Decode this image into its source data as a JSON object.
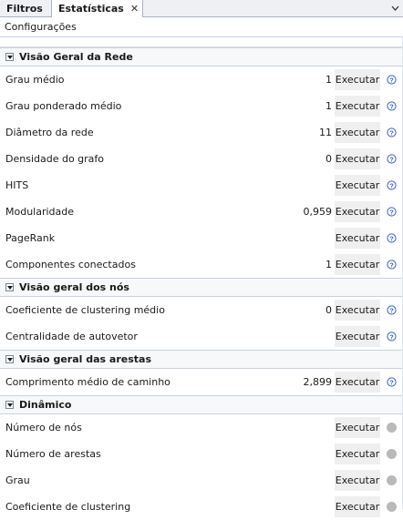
{
  "tabs": [
    {
      "label": "Filtros",
      "active": false
    },
    {
      "label": "Estatísticas",
      "active": true,
      "close": "✕"
    }
  ],
  "toolbar": {
    "configurations_label": "Configurações"
  },
  "run_label": "Executar",
  "sections": [
    {
      "title": "Visão Geral da Rede",
      "rows": [
        {
          "label": "Grau médio",
          "value": "1",
          "indicator": "help"
        },
        {
          "label": "Grau ponderado médio",
          "value": "1",
          "indicator": "help"
        },
        {
          "label": "Diâmetro da rede",
          "value": "11",
          "indicator": "help"
        },
        {
          "label": "Densidade do grafo",
          "value": "0",
          "indicator": "help"
        },
        {
          "label": "HITS",
          "value": "",
          "indicator": "help"
        },
        {
          "label": "Modularidade",
          "value": "0,959",
          "indicator": "help"
        },
        {
          "label": "PageRank",
          "value": "",
          "indicator": "help"
        },
        {
          "label": "Componentes conectados",
          "value": "1",
          "indicator": "help"
        }
      ]
    },
    {
      "title": "Visão geral dos nós",
      "rows": [
        {
          "label": "Coeficiente de clustering médio",
          "value": "0",
          "indicator": "help"
        },
        {
          "label": "Centralidade de autovetor",
          "value": "",
          "indicator": "help"
        }
      ]
    },
    {
      "title": "Visão geral das arestas",
      "rows": [
        {
          "label": "Comprimento médio de caminho",
          "value": "2,899",
          "indicator": "help"
        }
      ]
    },
    {
      "title": "Dinâmico",
      "rows": [
        {
          "label": "Número de nós",
          "value": "",
          "indicator": "dot"
        },
        {
          "label": "Número de arestas",
          "value": "",
          "indicator": "dot"
        },
        {
          "label": "Grau",
          "value": "",
          "indicator": "dot"
        },
        {
          "label": "Coeficiente de clustering",
          "value": "",
          "indicator": "dot"
        }
      ]
    }
  ],
  "colors": {
    "help_icon": "#3b63c4",
    "inactive_dot": "#b9b9b9",
    "button_bg": "#efefef"
  }
}
